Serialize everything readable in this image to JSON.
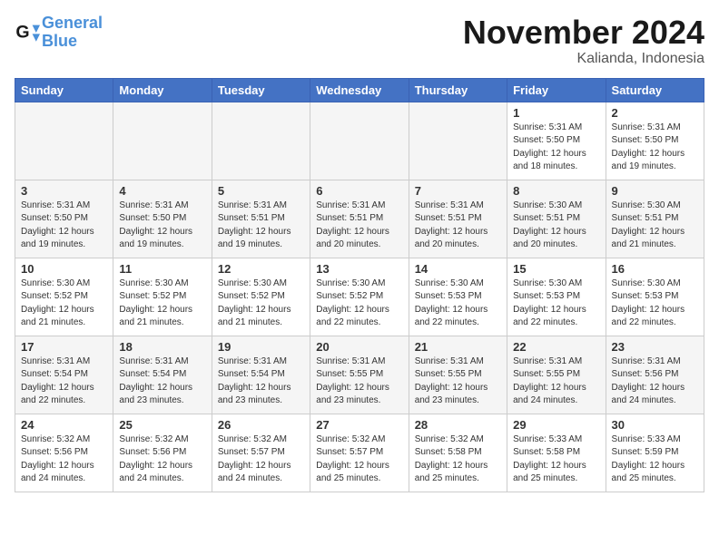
{
  "logo": {
    "line1": "General",
    "line2": "Blue"
  },
  "title": "November 2024",
  "location": "Kalianda, Indonesia",
  "days_of_week": [
    "Sunday",
    "Monday",
    "Tuesday",
    "Wednesday",
    "Thursday",
    "Friday",
    "Saturday"
  ],
  "weeks": [
    [
      {
        "day": "",
        "info": ""
      },
      {
        "day": "",
        "info": ""
      },
      {
        "day": "",
        "info": ""
      },
      {
        "day": "",
        "info": ""
      },
      {
        "day": "",
        "info": ""
      },
      {
        "day": "1",
        "info": "Sunrise: 5:31 AM\nSunset: 5:50 PM\nDaylight: 12 hours\nand 18 minutes."
      },
      {
        "day": "2",
        "info": "Sunrise: 5:31 AM\nSunset: 5:50 PM\nDaylight: 12 hours\nand 19 minutes."
      }
    ],
    [
      {
        "day": "3",
        "info": "Sunrise: 5:31 AM\nSunset: 5:50 PM\nDaylight: 12 hours\nand 19 minutes."
      },
      {
        "day": "4",
        "info": "Sunrise: 5:31 AM\nSunset: 5:50 PM\nDaylight: 12 hours\nand 19 minutes."
      },
      {
        "day": "5",
        "info": "Sunrise: 5:31 AM\nSunset: 5:51 PM\nDaylight: 12 hours\nand 19 minutes."
      },
      {
        "day": "6",
        "info": "Sunrise: 5:31 AM\nSunset: 5:51 PM\nDaylight: 12 hours\nand 20 minutes."
      },
      {
        "day": "7",
        "info": "Sunrise: 5:31 AM\nSunset: 5:51 PM\nDaylight: 12 hours\nand 20 minutes."
      },
      {
        "day": "8",
        "info": "Sunrise: 5:30 AM\nSunset: 5:51 PM\nDaylight: 12 hours\nand 20 minutes."
      },
      {
        "day": "9",
        "info": "Sunrise: 5:30 AM\nSunset: 5:51 PM\nDaylight: 12 hours\nand 21 minutes."
      }
    ],
    [
      {
        "day": "10",
        "info": "Sunrise: 5:30 AM\nSunset: 5:52 PM\nDaylight: 12 hours\nand 21 minutes."
      },
      {
        "day": "11",
        "info": "Sunrise: 5:30 AM\nSunset: 5:52 PM\nDaylight: 12 hours\nand 21 minutes."
      },
      {
        "day": "12",
        "info": "Sunrise: 5:30 AM\nSunset: 5:52 PM\nDaylight: 12 hours\nand 21 minutes."
      },
      {
        "day": "13",
        "info": "Sunrise: 5:30 AM\nSunset: 5:52 PM\nDaylight: 12 hours\nand 22 minutes."
      },
      {
        "day": "14",
        "info": "Sunrise: 5:30 AM\nSunset: 5:53 PM\nDaylight: 12 hours\nand 22 minutes."
      },
      {
        "day": "15",
        "info": "Sunrise: 5:30 AM\nSunset: 5:53 PM\nDaylight: 12 hours\nand 22 minutes."
      },
      {
        "day": "16",
        "info": "Sunrise: 5:30 AM\nSunset: 5:53 PM\nDaylight: 12 hours\nand 22 minutes."
      }
    ],
    [
      {
        "day": "17",
        "info": "Sunrise: 5:31 AM\nSunset: 5:54 PM\nDaylight: 12 hours\nand 22 minutes."
      },
      {
        "day": "18",
        "info": "Sunrise: 5:31 AM\nSunset: 5:54 PM\nDaylight: 12 hours\nand 23 minutes."
      },
      {
        "day": "19",
        "info": "Sunrise: 5:31 AM\nSunset: 5:54 PM\nDaylight: 12 hours\nand 23 minutes."
      },
      {
        "day": "20",
        "info": "Sunrise: 5:31 AM\nSunset: 5:55 PM\nDaylight: 12 hours\nand 23 minutes."
      },
      {
        "day": "21",
        "info": "Sunrise: 5:31 AM\nSunset: 5:55 PM\nDaylight: 12 hours\nand 23 minutes."
      },
      {
        "day": "22",
        "info": "Sunrise: 5:31 AM\nSunset: 5:55 PM\nDaylight: 12 hours\nand 24 minutes."
      },
      {
        "day": "23",
        "info": "Sunrise: 5:31 AM\nSunset: 5:56 PM\nDaylight: 12 hours\nand 24 minutes."
      }
    ],
    [
      {
        "day": "24",
        "info": "Sunrise: 5:32 AM\nSunset: 5:56 PM\nDaylight: 12 hours\nand 24 minutes."
      },
      {
        "day": "25",
        "info": "Sunrise: 5:32 AM\nSunset: 5:56 PM\nDaylight: 12 hours\nand 24 minutes."
      },
      {
        "day": "26",
        "info": "Sunrise: 5:32 AM\nSunset: 5:57 PM\nDaylight: 12 hours\nand 24 minutes."
      },
      {
        "day": "27",
        "info": "Sunrise: 5:32 AM\nSunset: 5:57 PM\nDaylight: 12 hours\nand 25 minutes."
      },
      {
        "day": "28",
        "info": "Sunrise: 5:32 AM\nSunset: 5:58 PM\nDaylight: 12 hours\nand 25 minutes."
      },
      {
        "day": "29",
        "info": "Sunrise: 5:33 AM\nSunset: 5:58 PM\nDaylight: 12 hours\nand 25 minutes."
      },
      {
        "day": "30",
        "info": "Sunrise: 5:33 AM\nSunset: 5:59 PM\nDaylight: 12 hours\nand 25 minutes."
      }
    ]
  ]
}
